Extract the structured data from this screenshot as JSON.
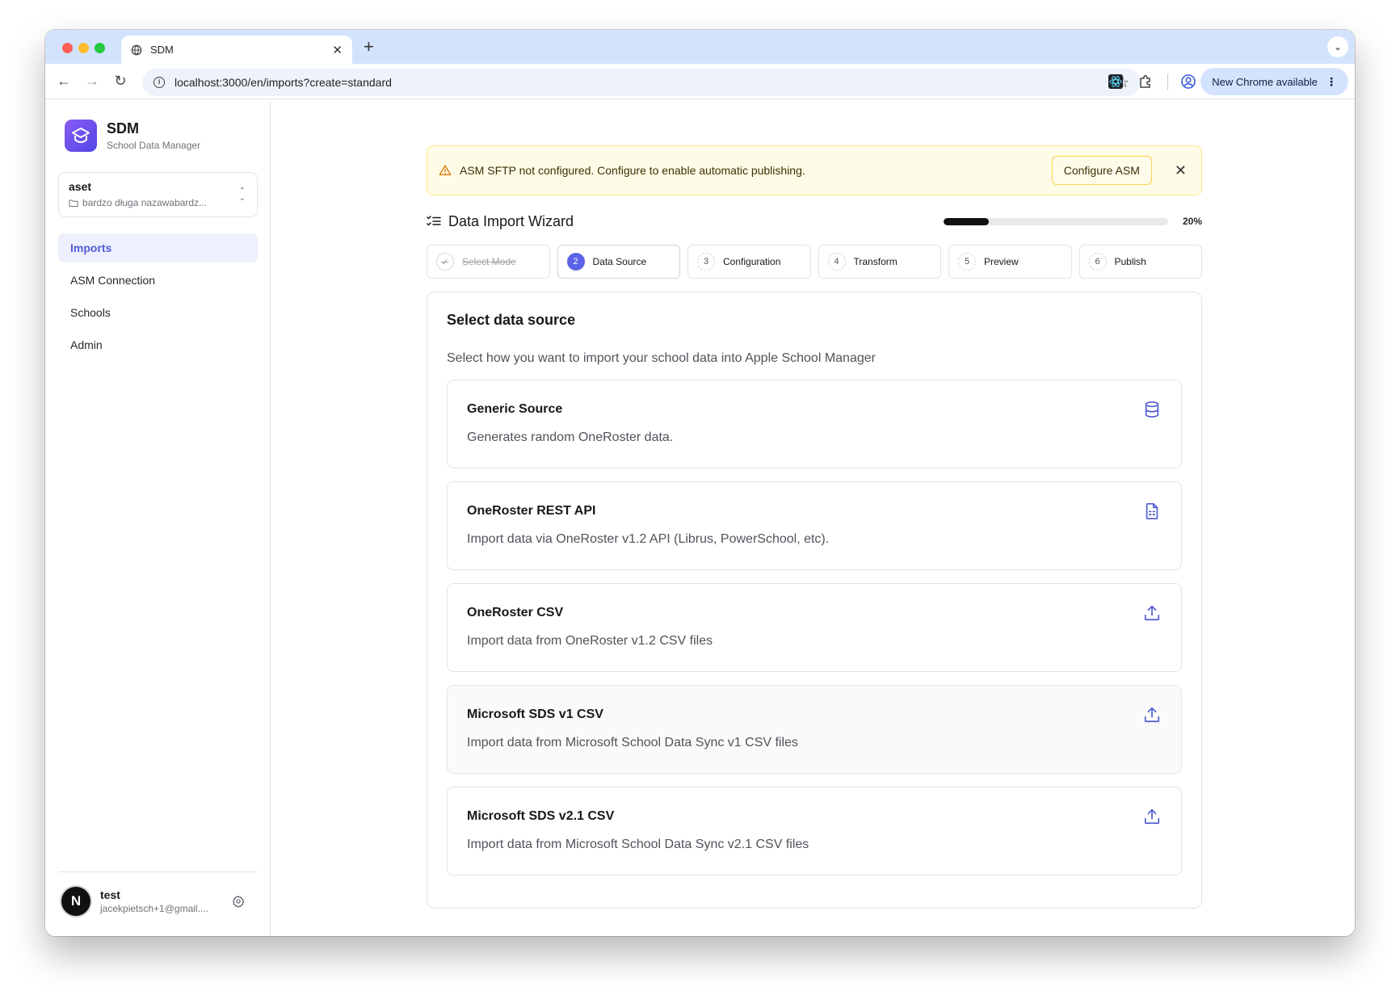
{
  "browser": {
    "tab_title": "SDM",
    "url": "localhost:3000/en/imports?create=standard",
    "update_pill": "New Chrome available"
  },
  "sidebar": {
    "brand_name": "SDM",
    "brand_subtitle": "School Data Manager",
    "org": {
      "name": "aset",
      "subtitle": "bardzo długa nazawabardz..."
    },
    "items": [
      {
        "label": "Imports",
        "active": true
      },
      {
        "label": "ASM Connection",
        "active": false
      },
      {
        "label": "Schools",
        "active": false
      },
      {
        "label": "Admin",
        "active": false
      }
    ],
    "user": {
      "initial": "N",
      "name": "test",
      "email": "jacekpietsch+1@gmail...."
    }
  },
  "alert": {
    "text": "ASM SFTP not configured. Configure to enable automatic publishing.",
    "button": "Configure ASM"
  },
  "wizard": {
    "title": "Data Import Wizard",
    "progress_percent": 20,
    "progress_label": "20%",
    "steps": [
      {
        "number": "1",
        "label": "Select Mode",
        "state": "done"
      },
      {
        "number": "2",
        "label": "Data Source",
        "state": "current"
      },
      {
        "number": "3",
        "label": "Configuration",
        "state": "upcoming"
      },
      {
        "number": "4",
        "label": "Transform",
        "state": "upcoming"
      },
      {
        "number": "5",
        "label": "Preview",
        "state": "upcoming"
      },
      {
        "number": "6",
        "label": "Publish",
        "state": "upcoming"
      }
    ]
  },
  "card": {
    "title": "Select data source",
    "description": "Select how you want to import your school data into Apple School Manager",
    "options": [
      {
        "title": "Generic Source",
        "description": "Generates random OneRoster data.",
        "icon": "database-icon"
      },
      {
        "title": "OneRoster REST API",
        "description": "Import data via OneRoster v1.2 API (Librus, PowerSchool, etc).",
        "icon": "file-spreadsheet-icon"
      },
      {
        "title": "OneRoster CSV",
        "description": "Import data from OneRoster v1.2 CSV files",
        "icon": "upload-icon"
      },
      {
        "title": "Microsoft SDS v1 CSV",
        "description": "Import data from Microsoft School Data Sync v1 CSV files",
        "icon": "upload-icon"
      },
      {
        "title": "Microsoft SDS v2.1 CSV",
        "description": "Import data from Microsoft School Data Sync v2.1 CSV files",
        "icon": "upload-icon"
      }
    ]
  },
  "colors": {
    "accent": "#5b63e6",
    "alert_bg": "#fefbe6",
    "alert_icon": "#d97706"
  }
}
